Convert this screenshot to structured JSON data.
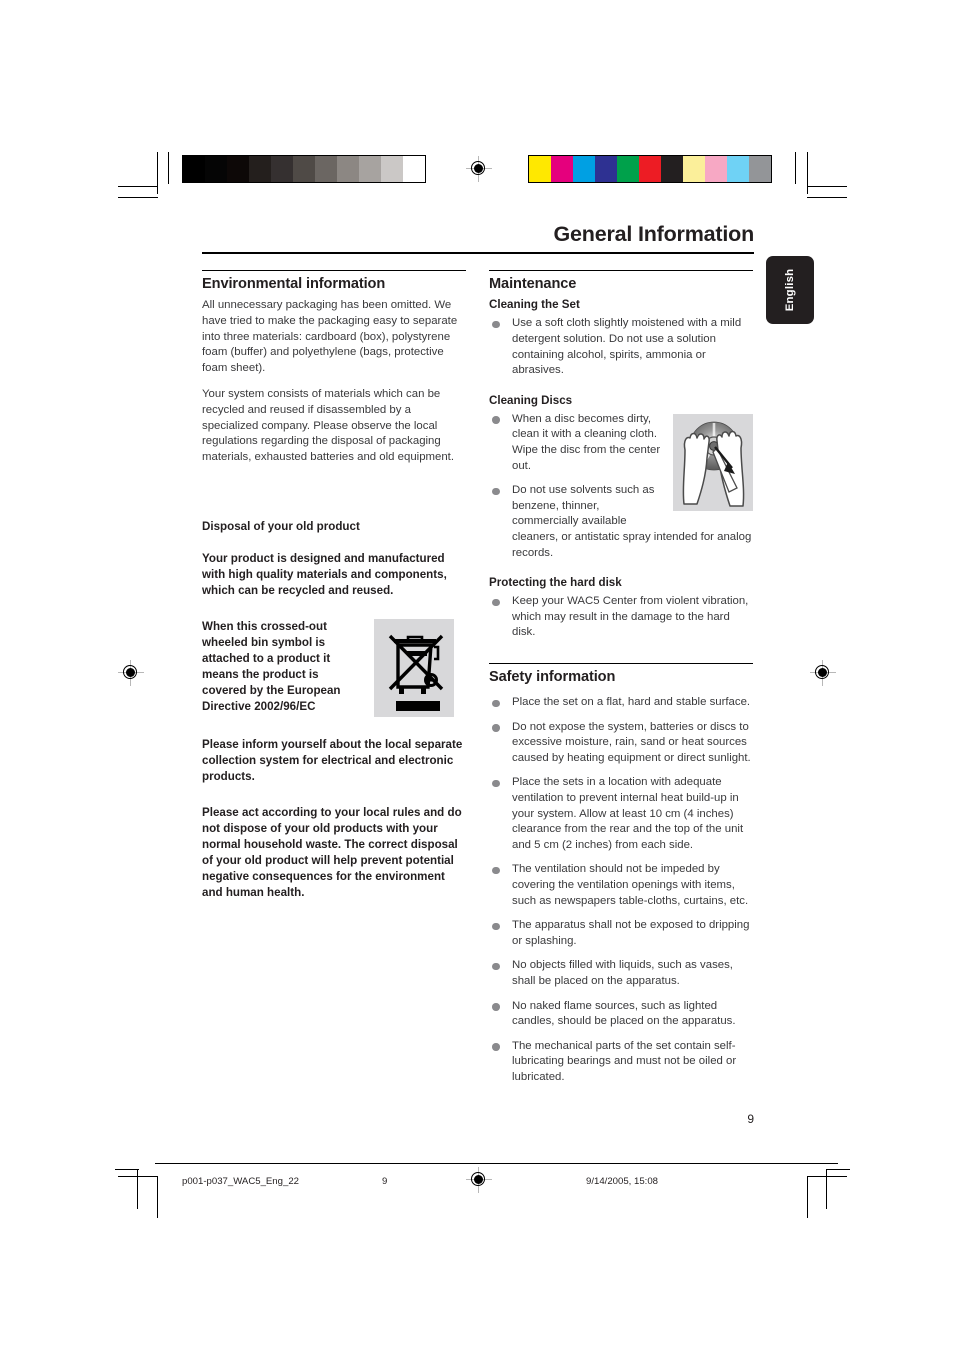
{
  "header": {
    "title": "General Information",
    "language_tab": "English"
  },
  "left_column": {
    "environmental": {
      "heading": "Environmental information",
      "paragraphs": [
        "All unnecessary packaging has been omitted. We have tried to make the packaging easy to separate into three materials: cardboard (box), polystyrene foam (buffer) and polyethylene (bags, protective foam sheet).",
        "Your system consists of materials which can be recycled and reused if disassembled by a specialized company. Please observe the local regulations regarding the disposal of packaging materials, exhausted batteries and old equipment."
      ]
    },
    "disposal": {
      "heading": "Disposal of  your old product",
      "intro": "Your product is designed and manufactured with high quality materials and components, which can be recycled and reused.",
      "weee_text": "When this crossed-out wheeled bin symbol is attached to a product it means the product is covered by the European Directive 2002/96/EC",
      "weee_icon": "crossed-out-wheeled-bin-icon",
      "paragraphs": [
        "Please inform yourself about the local separate collection system for electrical and electronic products.",
        "Please act according to your local rules and do not dispose of your old products with your normal household waste. The correct disposal of your old product will help prevent potential negative consequences for the environment and human health."
      ]
    }
  },
  "right_column": {
    "maintenance": {
      "heading": "Maintenance",
      "cleaning_set": {
        "subheading": "Cleaning the Set",
        "bullets": [
          "Use a soft cloth slightly moistened with a mild detergent solution. Do not use a solution containing alcohol, spirits, ammonia or abrasives."
        ]
      },
      "cleaning_discs": {
        "subheading": "Cleaning Discs",
        "figure_icon": "disc-cleaning-hands-icon",
        "bullets": [
          "When a disc becomes dirty, clean it with a cleaning cloth. Wipe the disc from the center out.",
          "Do not use solvents such as benzene, thinner, commercially available cleaners, or antistatic spray intended for analog records."
        ]
      },
      "hard_disk": {
        "subheading": "Protecting the hard disk",
        "bullets": [
          "Keep your  WAC5 Center from violent vibration, which may result in the damage to the hard disk."
        ]
      }
    },
    "safety": {
      "heading": "Safety information",
      "bullets": [
        "Place the set on a flat, hard and stable surface.",
        "Do not expose the system, batteries or discs to excessive moisture, rain, sand or heat sources caused by heating equipment or direct sunlight.",
        "Place the sets in a location with adequate ventilation to prevent internal heat build-up in your system.  Allow at least 10 cm (4 inches) clearance from the rear and the top of the unit and 5 cm (2 inches) from each side.",
        "The ventilation should not be impeded by covering the ventilation openings with items, such as newspapers table-cloths, curtains, etc.",
        " The apparatus shall not be exposed to dripping or splashing.",
        "No objects filled with liquids, such as vases, shall be placed on the apparatus.",
        "No naked flame sources, such as lighted candles, should be placed on the apparatus.",
        "The mechanical parts of the set contain self-lubricating bearings and must not be oiled or lubricated."
      ]
    }
  },
  "page_number": "9",
  "footer": {
    "filename": "p001-p037_WAC5_Eng_22",
    "page": "9",
    "timestamp": "9/14/2005, 15:08"
  },
  "printer_marks": {
    "grayscale_swatches": [
      "#000000",
      "#050505",
      "#0d0807",
      "#241f1d",
      "#353030",
      "#4f4a46",
      "#6b6662",
      "#8c8783",
      "#a7a3a0",
      "#cbc8c6",
      "#ffffff"
    ],
    "color_swatches": [
      "#ffe800",
      "#e5007d",
      "#00a0e3",
      "#2e3192",
      "#00a14b",
      "#ed1c24",
      "#231f20",
      "#fbef9a",
      "#f7a8c4",
      "#6fd2f5",
      "#939598"
    ]
  }
}
